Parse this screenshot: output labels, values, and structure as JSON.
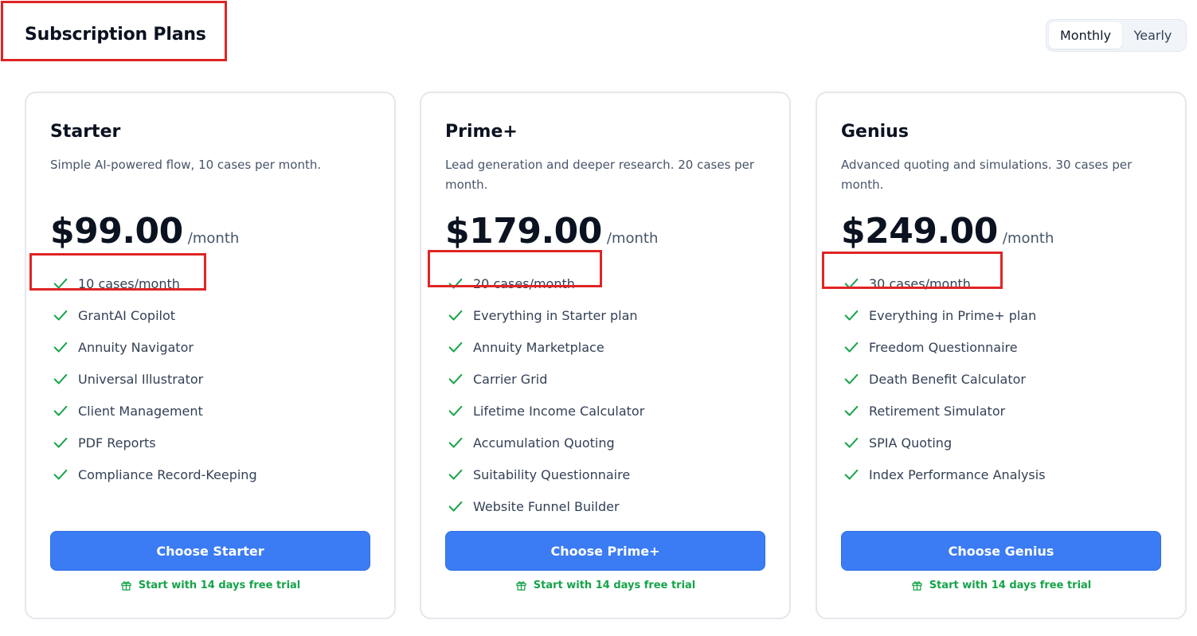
{
  "header": {
    "title": "Subscription Plans"
  },
  "billing_toggle": {
    "options": [
      "Monthly",
      "Yearly"
    ],
    "selected": "Monthly"
  },
  "plans": [
    {
      "name": "Starter",
      "description": "Simple AI-powered flow, 10 cases per month.",
      "price": "$99.00",
      "period": "/month",
      "features": [
        "10 cases/month",
        "GrantAI Copilot",
        "Annuity Navigator",
        "Universal Illustrator",
        "Client Management",
        "PDF Reports",
        "Compliance Record-Keeping"
      ],
      "cta": "Choose Starter",
      "trial": "Start with 14 days free trial"
    },
    {
      "name": "Prime+",
      "description": "Lead generation and deeper research. 20 cases per month.",
      "price": "$179.00",
      "period": "/month",
      "features": [
        "20 cases/month",
        "Everything in Starter plan",
        "Annuity Marketplace",
        "Carrier Grid",
        "Lifetime Income Calculator",
        "Accumulation Quoting",
        "Suitability Questionnaire",
        "Website Funnel Builder"
      ],
      "cta": "Choose Prime+",
      "trial": "Start with 14 days free trial"
    },
    {
      "name": "Genius",
      "description": "Advanced quoting and simulations. 30 cases per month.",
      "price": "$249.00",
      "period": "/month",
      "features": [
        "30 cases/month",
        "Everything in Prime+ plan",
        "Freedom Questionnaire",
        "Death Benefit Calculator",
        "Retirement Simulator",
        "SPIA Quoting",
        "Index Performance Analysis"
      ],
      "cta": "Choose Genius",
      "trial": "Start with 14 days free trial"
    }
  ],
  "icons": {
    "feature": "check-icon",
    "trial": "gift-icon"
  },
  "colors": {
    "accent": "#3b7cf4",
    "check": "#16a34a",
    "trial_text": "#16a34a",
    "highlight_box": "#e02424"
  }
}
